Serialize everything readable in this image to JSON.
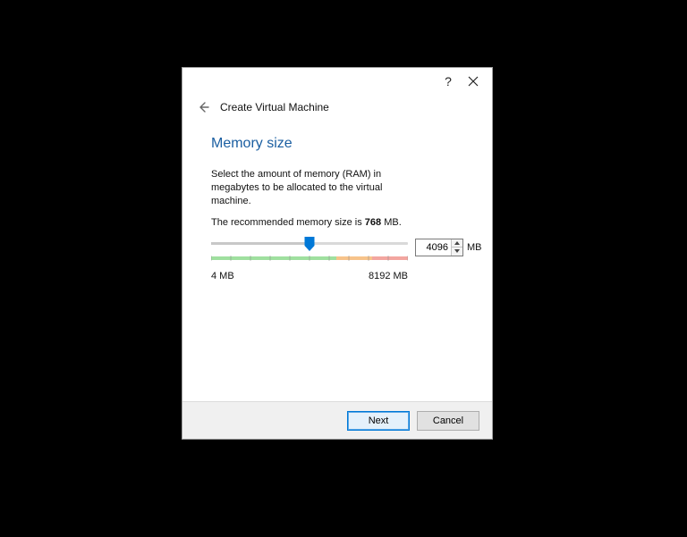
{
  "titlebar": {
    "help_tooltip": "?",
    "close_tooltip": "Close"
  },
  "header": {
    "title": "Create Virtual Machine"
  },
  "page": {
    "heading": "Memory size",
    "instruction": "Select the amount of memory (RAM) in megabytes to be allocated to the virtual machine.",
    "recommend_prefix": "The recommended memory size is ",
    "recommend_value": "768",
    "recommend_suffix": " MB."
  },
  "slider": {
    "min_label": "4 MB",
    "max_label": "8192 MB",
    "min": 4,
    "max": 8192,
    "value": 4096,
    "percent": 50
  },
  "spin": {
    "value": "4096",
    "unit": "MB"
  },
  "buttons": {
    "next": "Next",
    "cancel": "Cancel"
  }
}
